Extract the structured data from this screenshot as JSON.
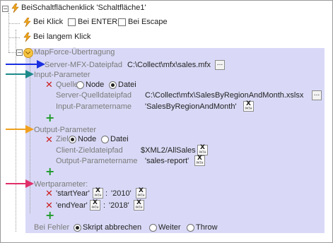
{
  "tree": {
    "root_label": "BeiSchaltflächenklick 'Schaltfläche1'",
    "event_bei_klick": "Bei Klick",
    "opt_enter": "Bei ENTER",
    "opt_escape": "Bei Escape",
    "event_langem_klick": "Bei langem Klick",
    "mapforce": {
      "title": "MapForce-Übertragung",
      "server_path_label": "Server-MFX-Dateipfad",
      "server_path_value": "C:\\Collect\\mfx\\sales.mfx",
      "input": {
        "header": "Input-Parameter",
        "quelle_label": "Quelle",
        "opt_node": "Node",
        "opt_datei": "Datei",
        "source_path_label": "Server-Quelldateipfad",
        "source_path_value": "C:\\Collect\\mfx\\SalesByRegionAndMonth.xslsx",
        "param_name_label": "Input-Parametername",
        "param_name_value": "'SalesByRegionAndMonth'"
      },
      "output": {
        "header": "Output-Parameter",
        "ziel_label": "Ziel",
        "opt_node": "Node",
        "opt_datei": "Datei",
        "client_path_label": "Client-Zieldateipfad",
        "client_path_value": "$XML2/AllSales",
        "param_name_label": "Output-Parametername",
        "param_name_value": "'sales-report'"
      },
      "values": {
        "header": "Wertparameter:",
        "row1_key": "'startYear'",
        "row1_value": "'2010'",
        "row2_key": "'endYear'",
        "row2_value": "'2018'",
        "separator": ":"
      },
      "error": {
        "label": "Bei Fehler",
        "opt1": "Skript abbrechen",
        "opt2": "Weiter",
        "opt3": "Throw"
      }
    },
    "xpath_badge": {
      "top": "X",
      "bottom": "PATH"
    },
    "browse_button": "..."
  },
  "colors": {
    "panel_bg": "#d9d9f7",
    "arrow_blue": "#1a2fe0",
    "arrow_teal": "#1c8a8a",
    "arrow_orange": "#f0a020",
    "arrow_pink": "#e0306a",
    "delete_red": "#cc1f1f",
    "add_green": "#1e9a2a"
  },
  "annotation_arrows": [
    "blue",
    "teal",
    "orange",
    "pink"
  ]
}
